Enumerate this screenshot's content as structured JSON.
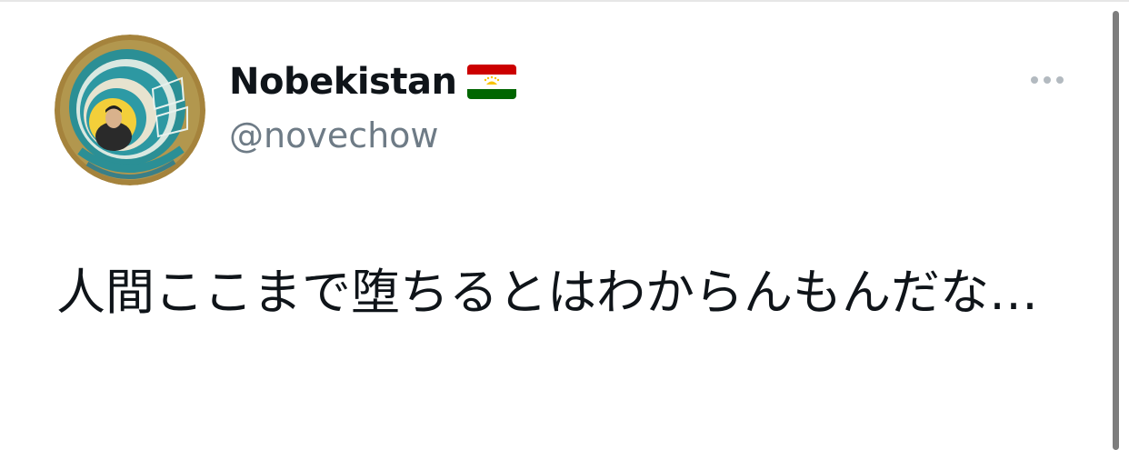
{
  "tweet": {
    "display_name": "Nobekistan",
    "handle": "@novechow",
    "text": "人間ここまで堕ちるとはわからんもんだな…",
    "flag_icon": "tajikistan-flag-icon",
    "avatar_icon": "profile-avatar-icon",
    "more_icon": "more-options-icon"
  },
  "colors": {
    "text_primary": "#0f1419",
    "text_secondary": "#6e7b86",
    "more_dots": "#b3bac0",
    "flag_red": "#cc0000",
    "flag_white": "#ffffff",
    "flag_green": "#006600",
    "flag_gold": "#f8c300"
  }
}
